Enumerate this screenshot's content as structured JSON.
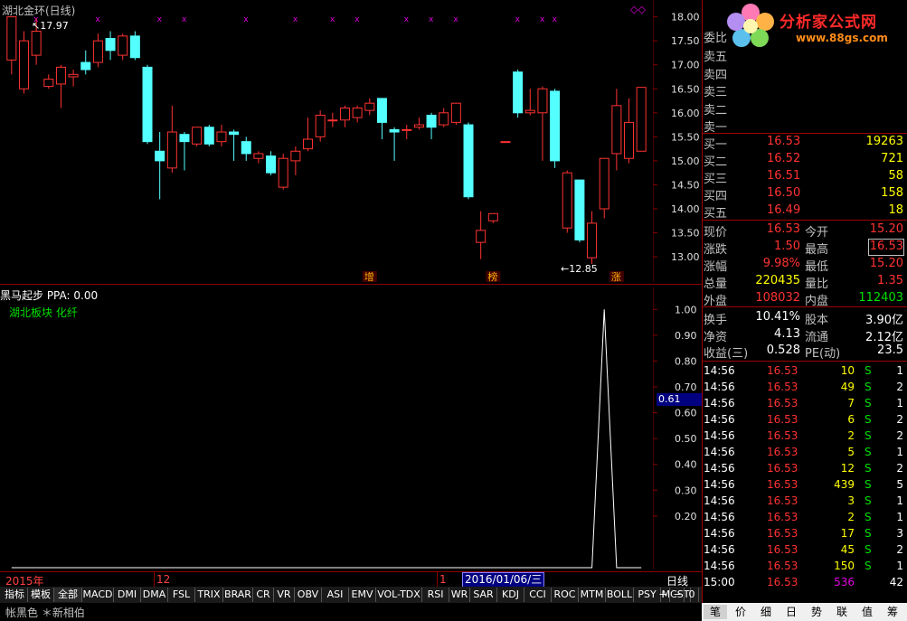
{
  "main": {
    "title": "湖北金环(日线)",
    "high_label": "17.97",
    "low_label": "←12.85",
    "price_axis": [
      "18.00",
      "17.50",
      "17.00",
      "16.50",
      "16.00",
      "15.50",
      "15.00",
      "14.50",
      "14.00",
      "13.50",
      "13.00"
    ],
    "markers": [
      "增",
      "榜",
      "涨"
    ]
  },
  "indicator": {
    "title": "黑马起步  PPA: 0.00",
    "legend": "湖北板块 化纤",
    "axis": [
      "1.00",
      "0.90",
      "0.80",
      "0.70",
      "0.60",
      "0.50",
      "0.40",
      "0.30",
      "0.20"
    ],
    "cursor_value": "0.61"
  },
  "date_bar": {
    "year": "2015年",
    "m12": "12",
    "m1": "1",
    "selected_date": "2016/01/06/三",
    "period": "日线"
  },
  "tabs": [
    "指标",
    "模板",
    "全部",
    "MACD",
    "DMI",
    "DMA",
    "FSL",
    "TRIX",
    "BRAR",
    "CR",
    "VR",
    "OBV",
    "ASI",
    "EMV",
    "VOL-TDX",
    "RSI",
    "WR",
    "SAR",
    "KDJ",
    "CCI",
    "ROC",
    "MTM",
    "BOLL",
    "PSY",
    "MCST"
  ],
  "tab_controls": [
    "+",
    "−",
    "0"
  ],
  "bottom_strip": "帐黑色  ＊新相伯",
  "logo": {
    "name": "分析家公式网",
    "url": "www.88gs.com"
  },
  "quote": {
    "committee": "委比",
    "sells": [
      {
        "label": "卖五",
        "price": "",
        "vol": ""
      },
      {
        "label": "卖四",
        "price": "",
        "vol": ""
      },
      {
        "label": "卖三",
        "price": "",
        "vol": ""
      },
      {
        "label": "卖二",
        "price": "",
        "vol": ""
      },
      {
        "label": "卖一",
        "price": "",
        "vol": ""
      }
    ],
    "buys": [
      {
        "label": "买一",
        "price": "16.53",
        "vol": "19263"
      },
      {
        "label": "买二",
        "price": "16.52",
        "vol": "721"
      },
      {
        "label": "买三",
        "price": "16.51",
        "vol": "58"
      },
      {
        "label": "买四",
        "price": "16.50",
        "vol": "158"
      },
      {
        "label": "买五",
        "price": "16.49",
        "vol": "18"
      }
    ],
    "stats": [
      {
        "l1": "现价",
        "v1": "16.53",
        "l2": "今开",
        "v2": "15.20"
      },
      {
        "l1": "涨跌",
        "v1": "1.50",
        "l2": "最高",
        "v2": "16.53"
      },
      {
        "l1": "涨幅",
        "v1": "9.98%",
        "l2": "最低",
        "v2": "15.20"
      },
      {
        "l1": "总量",
        "v1": "220435",
        "l2": "量比",
        "v2": "1.35"
      },
      {
        "l1": "外盘",
        "v1": "108032",
        "l2": "内盘",
        "v2": "112403"
      }
    ],
    "fin": [
      {
        "l1": "换手",
        "v1": "10.41%",
        "l2": "股本",
        "v2": "3.90亿"
      },
      {
        "l1": "净资",
        "v1": "4.13",
        "l2": "流通",
        "v2": "2.12亿"
      },
      {
        "l1": "收益(三)",
        "v1": "0.528",
        "l2": "PE(动)",
        "v2": "23.5"
      }
    ]
  },
  "ticks": [
    {
      "t": "14:56",
      "p": "16.53",
      "v": "10",
      "s": "S",
      "n": "1"
    },
    {
      "t": "14:56",
      "p": "16.53",
      "v": "49",
      "s": "S",
      "n": "2"
    },
    {
      "t": "14:56",
      "p": "16.53",
      "v": "7",
      "s": "S",
      "n": "1"
    },
    {
      "t": "14:56",
      "p": "16.53",
      "v": "6",
      "s": "S",
      "n": "2"
    },
    {
      "t": "14:56",
      "p": "16.53",
      "v": "2",
      "s": "S",
      "n": "2"
    },
    {
      "t": "14:56",
      "p": "16.53",
      "v": "5",
      "s": "S",
      "n": "1"
    },
    {
      "t": "14:56",
      "p": "16.53",
      "v": "12",
      "s": "S",
      "n": "2"
    },
    {
      "t": "14:56",
      "p": "16.53",
      "v": "439",
      "s": "S",
      "n": "5"
    },
    {
      "t": "14:56",
      "p": "16.53",
      "v": "3",
      "s": "S",
      "n": "1"
    },
    {
      "t": "14:56",
      "p": "16.53",
      "v": "2",
      "s": "S",
      "n": "1"
    },
    {
      "t": "14:56",
      "p": "16.53",
      "v": "17",
      "s": "S",
      "n": "3"
    },
    {
      "t": "14:56",
      "p": "16.53",
      "v": "45",
      "s": "S",
      "n": "2"
    },
    {
      "t": "14:56",
      "p": "16.53",
      "v": "150",
      "s": "S",
      "n": "1"
    },
    {
      "t": "15:00",
      "p": "16.53",
      "v": "536",
      "s": "",
      "n": "42"
    }
  ],
  "panel_tabs": [
    "笔",
    "价",
    "细",
    "日",
    "势",
    "联",
    "值",
    "筹"
  ],
  "chart_data": {
    "type": "candlestick",
    "ylim": [
      12.7,
      18.2
    ],
    "candles": [
      {
        "o": 17.1,
        "c": 18.0,
        "h": 18.0,
        "l": 16.8
      },
      {
        "o": 16.5,
        "c": 17.5,
        "h": 17.7,
        "l": 16.4
      },
      {
        "o": 17.2,
        "c": 17.7,
        "h": 17.97,
        "l": 17.0
      },
      {
        "o": 16.55,
        "c": 16.7,
        "h": 16.8,
        "l": 16.5
      },
      {
        "o": 16.6,
        "c": 16.95,
        "h": 17.0,
        "l": 16.1
      },
      {
        "o": 16.75,
        "c": 16.8,
        "h": 16.9,
        "l": 16.55
      },
      {
        "o": 17.05,
        "c": 16.9,
        "h": 17.3,
        "l": 16.8
      },
      {
        "o": 17.05,
        "c": 17.5,
        "h": 17.65,
        "l": 16.95
      },
      {
        "o": 17.55,
        "c": 17.3,
        "h": 17.7,
        "l": 17.1
      },
      {
        "o": 17.2,
        "c": 17.6,
        "h": 17.65,
        "l": 17.1
      },
      {
        "o": 17.6,
        "c": 17.15,
        "h": 17.7,
        "l": 17.1
      },
      {
        "o": 16.95,
        "c": 15.4,
        "h": 17.0,
        "l": 15.35
      },
      {
        "o": 15.2,
        "c": 15.0,
        "h": 15.6,
        "l": 14.2
      },
      {
        "o": 14.85,
        "c": 15.6,
        "h": 16.15,
        "l": 14.75
      },
      {
        "o": 15.55,
        "c": 15.4,
        "h": 15.6,
        "l": 14.8
      },
      {
        "o": 15.35,
        "c": 15.7,
        "h": 15.7,
        "l": 15.3
      },
      {
        "o": 15.7,
        "c": 15.35,
        "h": 15.75,
        "l": 15.3
      },
      {
        "o": 15.4,
        "c": 15.6,
        "h": 15.75,
        "l": 15.3
      },
      {
        "o": 15.6,
        "c": 15.55,
        "h": 15.65,
        "l": 15.0
      },
      {
        "o": 15.4,
        "c": 15.15,
        "h": 15.5,
        "l": 15.0
      },
      {
        "o": 15.05,
        "c": 15.15,
        "h": 15.2,
        "l": 14.95
      },
      {
        "o": 15.1,
        "c": 14.75,
        "h": 15.2,
        "l": 14.7
      },
      {
        "o": 14.45,
        "c": 15.05,
        "h": 15.15,
        "l": 14.4
      },
      {
        "o": 15.0,
        "c": 15.2,
        "h": 15.3,
        "l": 14.7
      },
      {
        "o": 15.25,
        "c": 15.45,
        "h": 15.9,
        "l": 15.2
      },
      {
        "o": 15.5,
        "c": 15.95,
        "h": 16.05,
        "l": 15.4
      },
      {
        "o": 15.85,
        "c": 15.85,
        "h": 16.0,
        "l": 15.7
      },
      {
        "o": 15.85,
        "c": 16.1,
        "h": 16.15,
        "l": 15.7
      },
      {
        "o": 15.9,
        "c": 16.1,
        "h": 16.15,
        "l": 15.8
      },
      {
        "o": 16.05,
        "c": 16.2,
        "h": 16.3,
        "l": 15.95
      },
      {
        "o": 16.3,
        "c": 15.8,
        "h": 16.3,
        "l": 15.45
      },
      {
        "o": 15.65,
        "c": 15.6,
        "h": 15.7,
        "l": 15.0
      },
      {
        "o": 15.65,
        "c": 15.65,
        "h": 15.75,
        "l": 15.45
      },
      {
        "o": 15.7,
        "c": 15.75,
        "h": 15.9,
        "l": 15.65
      },
      {
        "o": 15.95,
        "c": 15.7,
        "h": 16.0,
        "l": 15.45
      },
      {
        "o": 15.75,
        "c": 16.0,
        "h": 16.1,
        "l": 15.7
      },
      {
        "o": 15.8,
        "c": 16.2,
        "h": 16.2,
        "l": 15.75
      },
      {
        "o": 15.75,
        "c": 14.25,
        "h": 15.8,
        "l": 14.2
      },
      {
        "o": 13.3,
        "c": 13.55,
        "h": 13.95,
        "l": 12.95
      },
      {
        "o": 13.75,
        "c": 13.9,
        "h": 13.9,
        "l": 13.7
      },
      {
        "o": 15.4,
        "c": 15.4,
        "h": 15.4,
        "l": 15.4
      },
      {
        "o": 16.85,
        "c": 16.0,
        "h": 16.9,
        "l": 15.9
      },
      {
        "o": 16.0,
        "c": 16.05,
        "h": 16.5,
        "l": 15.95
      },
      {
        "o": 16.0,
        "c": 16.5,
        "h": 16.55,
        "l": 15.0
      },
      {
        "o": 16.45,
        "c": 15.0,
        "h": 16.5,
        "l": 14.85
      },
      {
        "o": 13.6,
        "c": 14.75,
        "h": 14.8,
        "l": 13.5
      },
      {
        "o": 14.6,
        "c": 13.35,
        "h": 14.6,
        "l": 13.3
      },
      {
        "o": 12.98,
        "c": 13.7,
        "h": 13.95,
        "l": 12.85
      },
      {
        "o": 14.0,
        "c": 15.05,
        "h": 15.05,
        "l": 13.8
      },
      {
        "o": 15.15,
        "c": 16.15,
        "h": 16.5,
        "l": 14.8
      },
      {
        "o": 15.05,
        "c": 15.8,
        "h": 16.3,
        "l": 14.95
      },
      {
        "o": 15.2,
        "c": 16.53,
        "h": 16.53,
        "l": 15.2
      }
    ],
    "indicator_values": [
      0,
      0,
      0,
      0,
      0,
      0,
      0,
      0,
      0,
      0,
      0,
      0,
      0,
      0,
      0,
      0,
      0,
      0,
      0,
      0,
      0,
      0,
      0,
      0,
      0,
      0,
      0,
      0,
      0,
      0,
      0,
      0,
      0,
      0,
      0,
      0,
      0,
      0,
      0,
      0,
      0,
      0,
      0,
      0,
      0,
      0,
      0,
      0,
      1.0,
      0,
      0,
      0
    ],
    "indicator_ylim": [
      0,
      1.05
    ]
  },
  "colors": {
    "up": "#ff3232",
    "down": "#54ffff",
    "grid": "#8a0000",
    "marker": "#e000e0"
  }
}
